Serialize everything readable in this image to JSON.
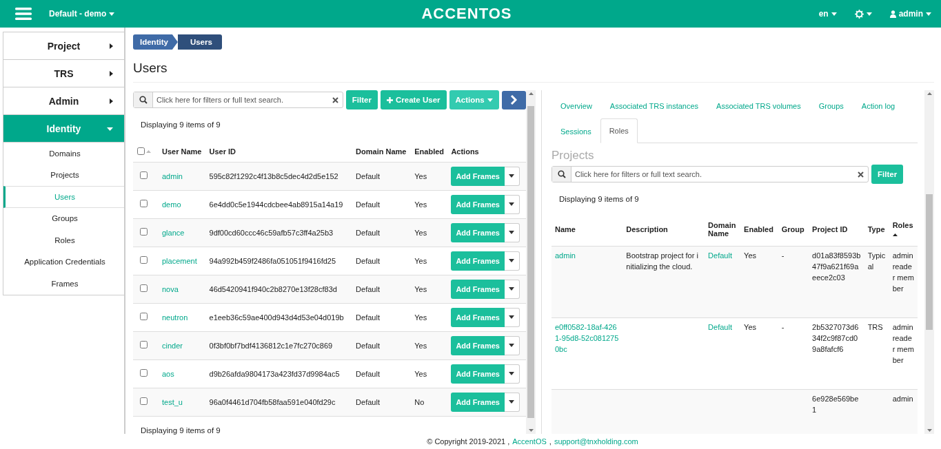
{
  "header": {
    "project_menu": "Default - demo",
    "logo": "ACCENTOS",
    "language": "en",
    "user": "admin"
  },
  "sidebar": {
    "items": [
      {
        "label": "Project",
        "expanded": false
      },
      {
        "label": "TRS",
        "expanded": false
      },
      {
        "label": "Admin",
        "expanded": false
      },
      {
        "label": "Identity",
        "expanded": true,
        "children": [
          {
            "label": "Domains",
            "selected": false
          },
          {
            "label": "Projects",
            "selected": false
          },
          {
            "label": "Users",
            "selected": true
          },
          {
            "label": "Groups",
            "selected": false
          },
          {
            "label": "Roles",
            "selected": false
          },
          {
            "label": "Application Credentials",
            "selected": false
          },
          {
            "label": "Frames",
            "selected": false
          }
        ]
      }
    ]
  },
  "breadcrumb": [
    "Identity",
    "Users"
  ],
  "page_title": "Users",
  "users": {
    "search_placeholder": "Click here for filters or full text search.",
    "filter_button": "Filter",
    "create_button": "Create User",
    "actions_button": "Actions",
    "count_top": "Displaying 9 items of 9",
    "count_bottom": "Displaying 9 items of 9",
    "select_all_checked": false,
    "columns": [
      "User Name",
      "User ID",
      "Domain Name",
      "Enabled",
      "Actions"
    ],
    "rows": [
      {
        "name": "admin",
        "id": "595c82f1292c4f13b8c5dec4d2d5e152",
        "domain": "Default",
        "enabled": "Yes",
        "action": "Add Frames",
        "checked": false
      },
      {
        "name": "demo",
        "id": "6e4dd0c5e1944cdcbee4ab8915a14a19",
        "domain": "Default",
        "enabled": "Yes",
        "action": "Add Frames",
        "checked": false
      },
      {
        "name": "glance",
        "id": "9df00cd60ccc46c59afb57c3ff4a25b3",
        "domain": "Default",
        "enabled": "Yes",
        "action": "Add Frames",
        "checked": false
      },
      {
        "name": "placement",
        "id": "94a992b459f2486fa051051f9416fd25",
        "domain": "Default",
        "enabled": "Yes",
        "action": "Add Frames",
        "checked": false
      },
      {
        "name": "nova",
        "id": "46d5420941f940c2b8270e13f28cf83d",
        "domain": "Default",
        "enabled": "Yes",
        "action": "Add Frames",
        "checked": false
      },
      {
        "name": "neutron",
        "id": "e1eeb36c59ae400d943d4d53e04d019b",
        "domain": "Default",
        "enabled": "Yes",
        "action": "Add Frames",
        "checked": false
      },
      {
        "name": "cinder",
        "id": "0f3bf0bf7bdf4136812c1e7fc270c869",
        "domain": "Default",
        "enabled": "Yes",
        "action": "Add Frames",
        "checked": false
      },
      {
        "name": "aos",
        "id": "d9b26afda9804173a423fd37d9984ac5",
        "domain": "Default",
        "enabled": "Yes",
        "action": "Add Frames",
        "checked": false
      },
      {
        "name": "test_u",
        "id": "96a0f4461d704fb58faa591e040fd29c",
        "domain": "Default",
        "enabled": "No",
        "action": "Add Frames",
        "checked": false
      }
    ]
  },
  "detail": {
    "tabs": [
      {
        "label": "Overview",
        "selected": false
      },
      {
        "label": "Associated TRS instances",
        "selected": false
      },
      {
        "label": "Associated TRS volumes",
        "selected": false
      },
      {
        "label": "Groups",
        "selected": false
      },
      {
        "label": "Action log",
        "selected": false
      },
      {
        "label": "Sessions",
        "selected": false
      },
      {
        "label": "Roles",
        "selected": true
      }
    ],
    "section_title": "Projects",
    "search_placeholder": "Click here for filters or full text search.",
    "filter_button": "Filter",
    "count": "Displaying 9 items of 9",
    "columns": [
      "Name",
      "Description",
      "Domain Name",
      "Enabled",
      "Group",
      "Project ID",
      "Type",
      "Roles"
    ],
    "rows": [
      {
        "name": "admin",
        "description": "Bootstrap project for initializing the cloud.",
        "domain": "Default",
        "enabled": "Yes",
        "group": "-",
        "project_id": "d01a83f8593b47f9a621f69aeece2c03",
        "type": "Typical",
        "roles": "admin reader member"
      },
      {
        "name": "e0ff0582-18af-4261-95d8-52c0812750bc",
        "description": "",
        "domain": "Default",
        "enabled": "Yes",
        "group": "-",
        "project_id": "2b5327073d634f2c9f87cd09a8fafcf6",
        "type": "TRS",
        "roles": "admin reader member"
      },
      {
        "name": "",
        "description": "",
        "domain": "",
        "enabled": "",
        "group": "",
        "project_id": "6e928e569be1",
        "type": "",
        "roles": "admin"
      }
    ]
  },
  "footer": {
    "copyright": "© Copyright 2019-2021 ,",
    "product_link": "AccentOS",
    "separator": ",",
    "email_link": "support@tnxholding.com"
  }
}
